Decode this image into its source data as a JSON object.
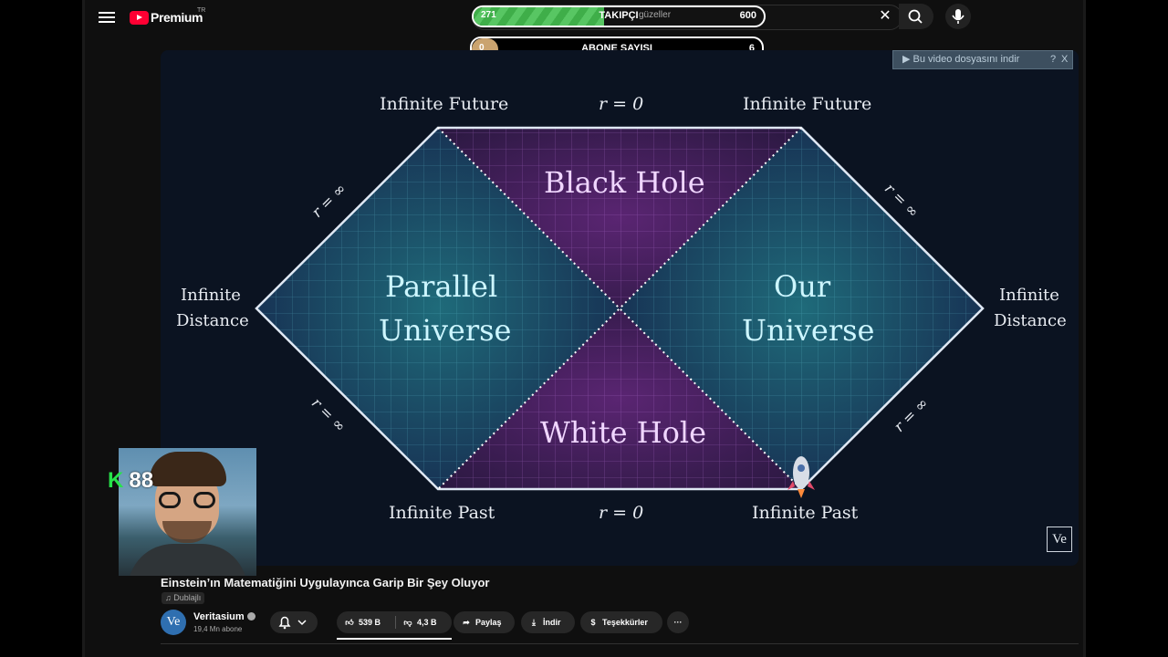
{
  "masthead": {
    "logo_text": "Premium",
    "logo_country": "TR",
    "search_text": "güzeller",
    "clear_icon": "close-icon",
    "search_icon": "search-icon",
    "mic_icon": "mic-icon"
  },
  "overlay_bars": [
    {
      "left": "271",
      "label": "TAKIPÇI",
      "right": "600",
      "progress": 0.45
    },
    {
      "left": "0",
      "label": "ABONE SAYISI",
      "right": "6",
      "progress": 0.09
    }
  ],
  "video": {
    "download_banner": "▶ Bu video dosyasını indir",
    "download_help": "?",
    "download_close": "X",
    "watermark": "Ve",
    "diagram": {
      "top_left": "Infinite Future",
      "top_mid": "r = 0",
      "top_right": "Infinite Future",
      "bottom_left": "Infinite Past",
      "bottom_mid": "r = 0",
      "bottom_right": "Infinite Past",
      "left_top": "Infinite",
      "left_bottom": "Distance",
      "right_top": "Infinite",
      "right_bottom": "Distance",
      "black_hole": "Black Hole",
      "white_hole": "White Hole",
      "parallel_1": "Parallel",
      "parallel_2": "Universe",
      "our_1": "Our",
      "our_2": "Universe",
      "r_inf": "r = ∞"
    },
    "webcam_badge_k": "K",
    "webcam_badge_num": "88"
  },
  "info": {
    "title": "Einstein’ın Matematiğini Uygulayınca Garip Bir Şey Oluyor",
    "dub_label": "Dublajlı",
    "channel_initials": "Ve",
    "channel_name": "Veritasium",
    "subscribers": "19,4 Mn abone",
    "likes": "539 B",
    "dislikes": "4,3 B",
    "share": "Paylaş",
    "download": "İndir",
    "thanks": "Teşekkürler",
    "more": "···"
  }
}
